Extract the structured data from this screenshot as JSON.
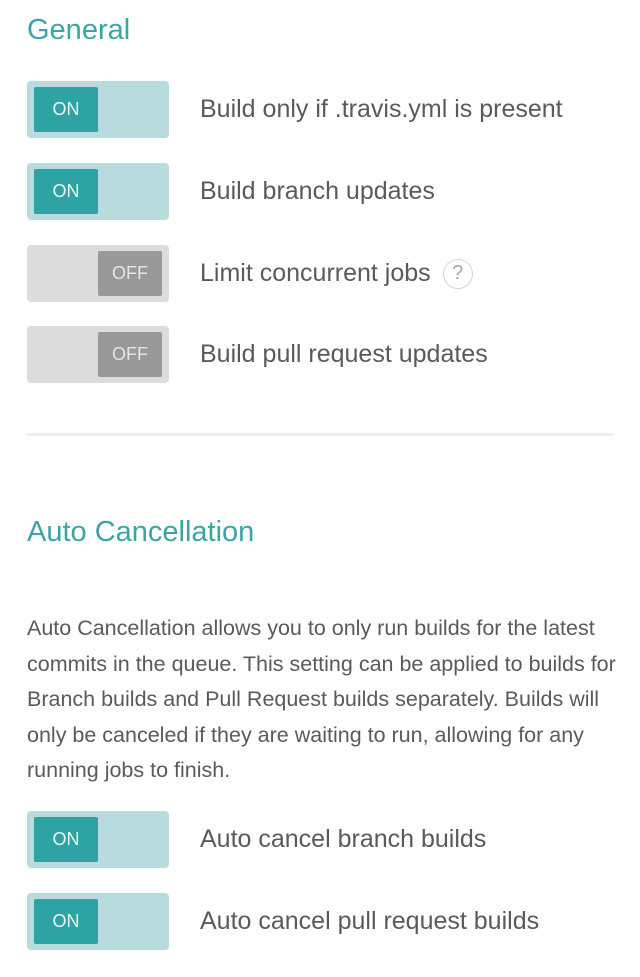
{
  "general": {
    "title": "General",
    "settings": [
      {
        "label": "Build only if .travis.yml is present",
        "state": "ON"
      },
      {
        "label": "Build branch updates",
        "state": "ON"
      },
      {
        "label": "Limit concurrent jobs",
        "state": "OFF",
        "help_icon": "question-circle-icon",
        "help_text": "?"
      },
      {
        "label": "Build pull request updates",
        "state": "OFF"
      }
    ]
  },
  "auto_cancellation": {
    "title": "Auto Cancellation",
    "description": "Auto Cancellation allows you to only run builds for the latest commits in the queue. This setting can be applied to builds for Branch builds and Pull Request builds separately. Builds will only be canceled if they are waiting to run, allowing for any running jobs to finish.",
    "settings": [
      {
        "label": "Auto cancel branch builds",
        "state": "ON"
      },
      {
        "label": "Auto cancel pull request builds",
        "state": "ON"
      }
    ]
  },
  "colors": {
    "accent": "#3ba5a5",
    "toggle_on_track": "#b8dcdd",
    "toggle_on_knob": "#2ea3a4",
    "toggle_off_track": "#dcdcdc",
    "toggle_off_knob": "#999999",
    "text": "#5a5a5a"
  }
}
